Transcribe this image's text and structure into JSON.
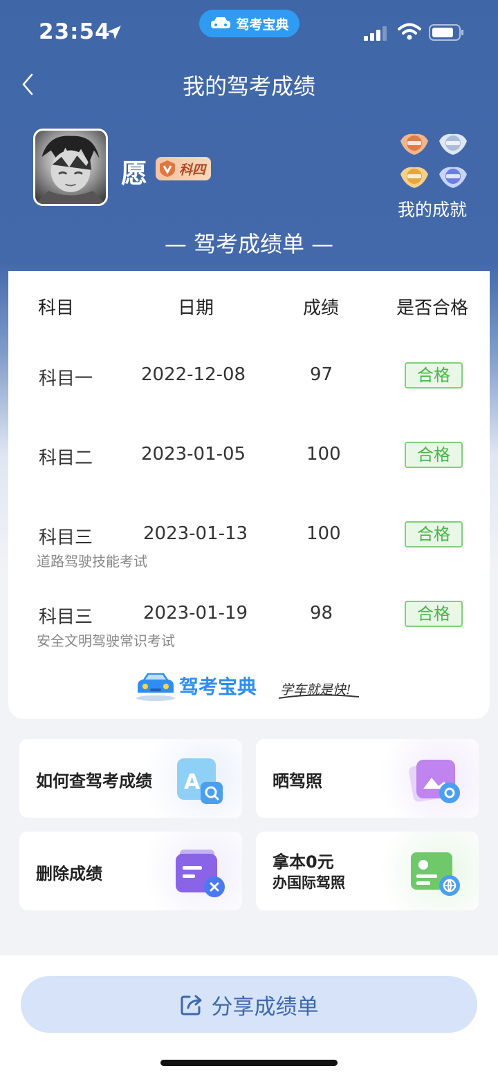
{
  "status_bar": {
    "time": "23:54"
  },
  "app_pill": {
    "label": "驾考宝典"
  },
  "header": {
    "title": "我的驾考成绩"
  },
  "profile": {
    "name": "愿",
    "level_badge": "科四",
    "achievement_label": "我的成就"
  },
  "report": {
    "title": "— 驾考成绩单 —",
    "columns": [
      "科目",
      "日期",
      "成绩",
      "是否合格"
    ],
    "rows": [
      {
        "subject": "科目一",
        "date": "2022-12-08",
        "score": "97",
        "result": "合格",
        "note": ""
      },
      {
        "subject": "科目二",
        "date": "2023-01-05",
        "score": "100",
        "result": "合格",
        "note": ""
      },
      {
        "subject": "科目三",
        "date": "2023-01-13",
        "score": "100",
        "result": "合格",
        "note": "道路驾驶技能考试"
      },
      {
        "subject": "科目三",
        "date": "2023-01-19",
        "score": "98",
        "result": "合格",
        "note": "安全文明驾驶常识考试"
      }
    ],
    "brand_name": "驾考宝典",
    "brand_slogan": "学车就是快!"
  },
  "tiles": {
    "check_score": "如何查驾考成绩",
    "show_license": "晒驾照",
    "delete_score": "删除成绩",
    "intl_license_line1": "拿本0元",
    "intl_license_line2": "办国际驾照"
  },
  "share": {
    "label": "分享成绩单"
  },
  "colors": {
    "header_bg": "#4469ab",
    "pass_green": "#49b648",
    "share_bg": "#d6e3f8",
    "share_text": "#3c68ad"
  }
}
